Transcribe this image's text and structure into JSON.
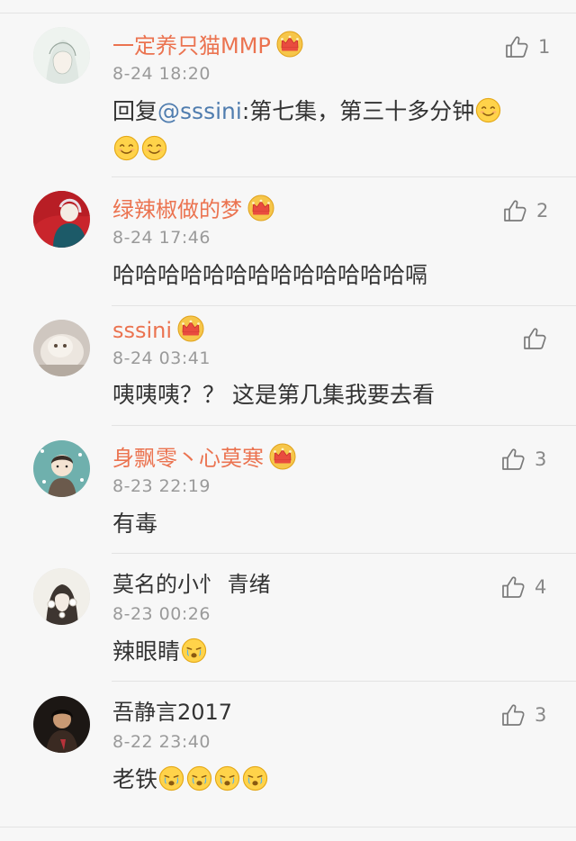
{
  "comments": [
    {
      "username": "一定养只猫MMP",
      "vip": true,
      "time": "8-24 18:20",
      "likes": "1",
      "reply_prefix": "回复",
      "mention": "@sssini",
      "text": ":第七集，第三十多分钟",
      "emojis_inline": 1,
      "emojis_line2": 2,
      "emoji_type": "smile-emoji",
      "avatar": "anime-girl-sketch-avatar"
    },
    {
      "username": "绿辣椒做的梦",
      "vip": true,
      "time": "8-24 17:46",
      "likes": "2",
      "text": "哈哈哈哈哈哈哈哈哈哈哈哈哈嗝",
      "avatar": "red-teal-illustration-avatar"
    },
    {
      "username": "sssini",
      "vip": true,
      "time": "8-24 03:41",
      "likes": "",
      "text": "咦咦咦？？ 这是第几集我要去看",
      "avatar": "fluffy-cat-avatar"
    },
    {
      "username": "身飘零丶心莫寒",
      "vip": true,
      "time": "8-23 22:19",
      "likes": "3",
      "text": "有毒",
      "avatar": "cartoon-boy-avatar"
    },
    {
      "username": "莫名的小忄 青绪",
      "vip": false,
      "time": "8-23 00:26",
      "likes": "4",
      "text": "辣眼睛",
      "emoji_count": 1,
      "emoji_type": "tearful-emoji",
      "avatar": "girl-with-flowers-avatar"
    },
    {
      "username": "吾静言2017",
      "vip": false,
      "time": "8-22 23:40",
      "likes": "3",
      "text": "老铁",
      "emoji_count": 4,
      "emoji_type": "tearful-emoji",
      "avatar": "dark-portrait-avatar"
    }
  ],
  "colors": {
    "vip_name": "#eb7350",
    "mention": "#507daf",
    "text": "#333333",
    "time": "#9a9a9a",
    "background": "#f7f7f7"
  },
  "icons": {
    "like": "thumbs-up-icon",
    "vip": "crown-icon"
  }
}
